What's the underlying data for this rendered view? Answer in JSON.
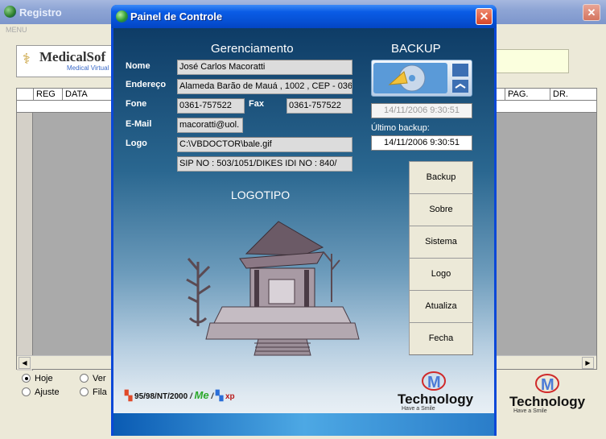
{
  "background_window": {
    "title": "Registro",
    "close_glyph": "✕",
    "menu_label": "MENU",
    "logo_text": "MedicalSof",
    "logo_sub": "Medical Virtual",
    "grid_columns": [
      "REG",
      "DATA",
      "PAG.",
      "DR."
    ],
    "radios": [
      {
        "label": "Hoje",
        "selected": true
      },
      {
        "label": "Ver",
        "selected": false
      },
      {
        "label": "Ajuste",
        "selected": false
      },
      {
        "label": "Fila",
        "selected": false
      }
    ],
    "tech_logo": {
      "letter": "M",
      "name": "Technology",
      "tagline": "Have a Smile"
    }
  },
  "modal": {
    "title": "Painel de Controle",
    "close_glyph": "✕",
    "heading_management": "Gerenciamento",
    "heading_backup": "BACKUP",
    "labels": {
      "name": "Nome",
      "address": "Endereço",
      "phone": "Fone",
      "fax": "Fax",
      "email": "E-Mail",
      "logo": "Logo"
    },
    "values": {
      "name": "José Carlos Macoratti",
      "address": "Alameda Barão de Mauá , 1002 , CEP - 036",
      "phone": "0361-757522",
      "fax": "0361-757522",
      "email": "macoratti@uol.",
      "logo_path": "C:\\VBDOCTOR\\bale.gif",
      "sip": "SIP NO : 503/1051/DIKES    IDI NO : 840/"
    },
    "backup_date": "14/11/2006 9:30:51",
    "last_backup_label": "Último backup:",
    "last_backup_value": "14/11/2006 9:30:51",
    "logotipo_label": "LOGOTIPO",
    "buttons": [
      "Backup",
      "Sobre",
      "Sistema",
      "Logo",
      "Atualiza",
      "Fecha"
    ],
    "os_text": "95/98/NT/2000",
    "me_text": "Me",
    "xp_text": "xp",
    "tech_logo": {
      "letter": "M",
      "name": "Technology",
      "tagline": "Have a Smile"
    }
  }
}
